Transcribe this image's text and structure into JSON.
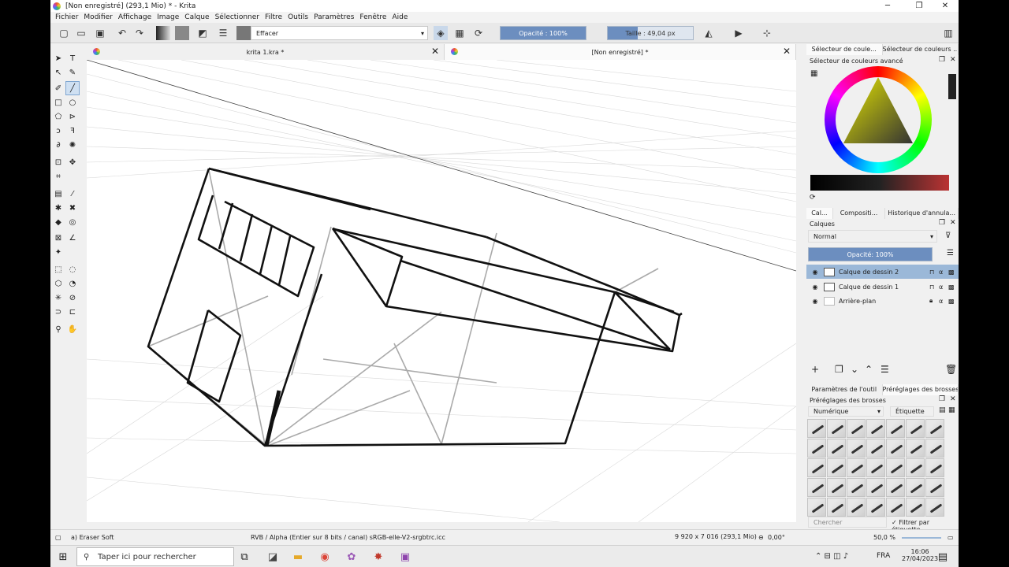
{
  "window": {
    "title": "[Non enregistré]  (293,1 Mio)  * - Krita",
    "minimize": "─",
    "maximize": "❐",
    "close": "✕"
  },
  "menu": [
    "Fichier",
    "Modifier",
    "Affichage",
    "Image",
    "Calque",
    "Sélectionner",
    "Filtre",
    "Outils",
    "Paramètres",
    "Fenêtre",
    "Aide"
  ],
  "toolbar": {
    "blend_mode": "Effacer",
    "opacity": "Opacité : 100%",
    "size": "Taille : 49,04 px"
  },
  "tabs": [
    {
      "label": "krita 1.kra *"
    },
    {
      "label": "[Non enregistré]  *"
    }
  ],
  "right_panel": {
    "top_tabs": [
      "Sélecteur de coule...",
      "Sélecteur de couleurs ..."
    ],
    "color_selector_title": "Sélecteur de couleurs avancé",
    "mid_tabs": [
      "Cal...",
      "Compositi...",
      "Historique d'annula..."
    ],
    "layers_title": "Calques",
    "blend_mode": "Normal",
    "opacity": "Opacité:  100%",
    "layers": [
      {
        "name": "Calque de dessin 2",
        "selected": true
      },
      {
        "name": "Calque de dessin 1",
        "selected": false
      },
      {
        "name": "Arrière-plan",
        "selected": false
      }
    ],
    "bottom_tabs": [
      "Paramètres de l'outil",
      "Préréglages des brosses"
    ],
    "presets_title": "Préréglages des brosses",
    "sort": "Numérique",
    "tag": "Étiquette",
    "search_placeholder": "Chercher",
    "filter_label": "Filtrer par étiquette"
  },
  "status": {
    "brush": "a) Eraser Soft",
    "color_space": "RVB / Alpha (Entier sur 8 bits / canal) sRGB-elle-V2-srgbtrc.icc",
    "size": "9 920 x 7 016 (293,1 Mio)",
    "rotation": "0,00°",
    "zoom": "50,0 %"
  },
  "taskbar": {
    "search": "Taper ici pour rechercher",
    "time": "16:06",
    "date": "27/04/2023",
    "lang": "FRA"
  },
  "colors": {
    "accent": "#9bb8d8",
    "slider": "#6c8ebf"
  }
}
